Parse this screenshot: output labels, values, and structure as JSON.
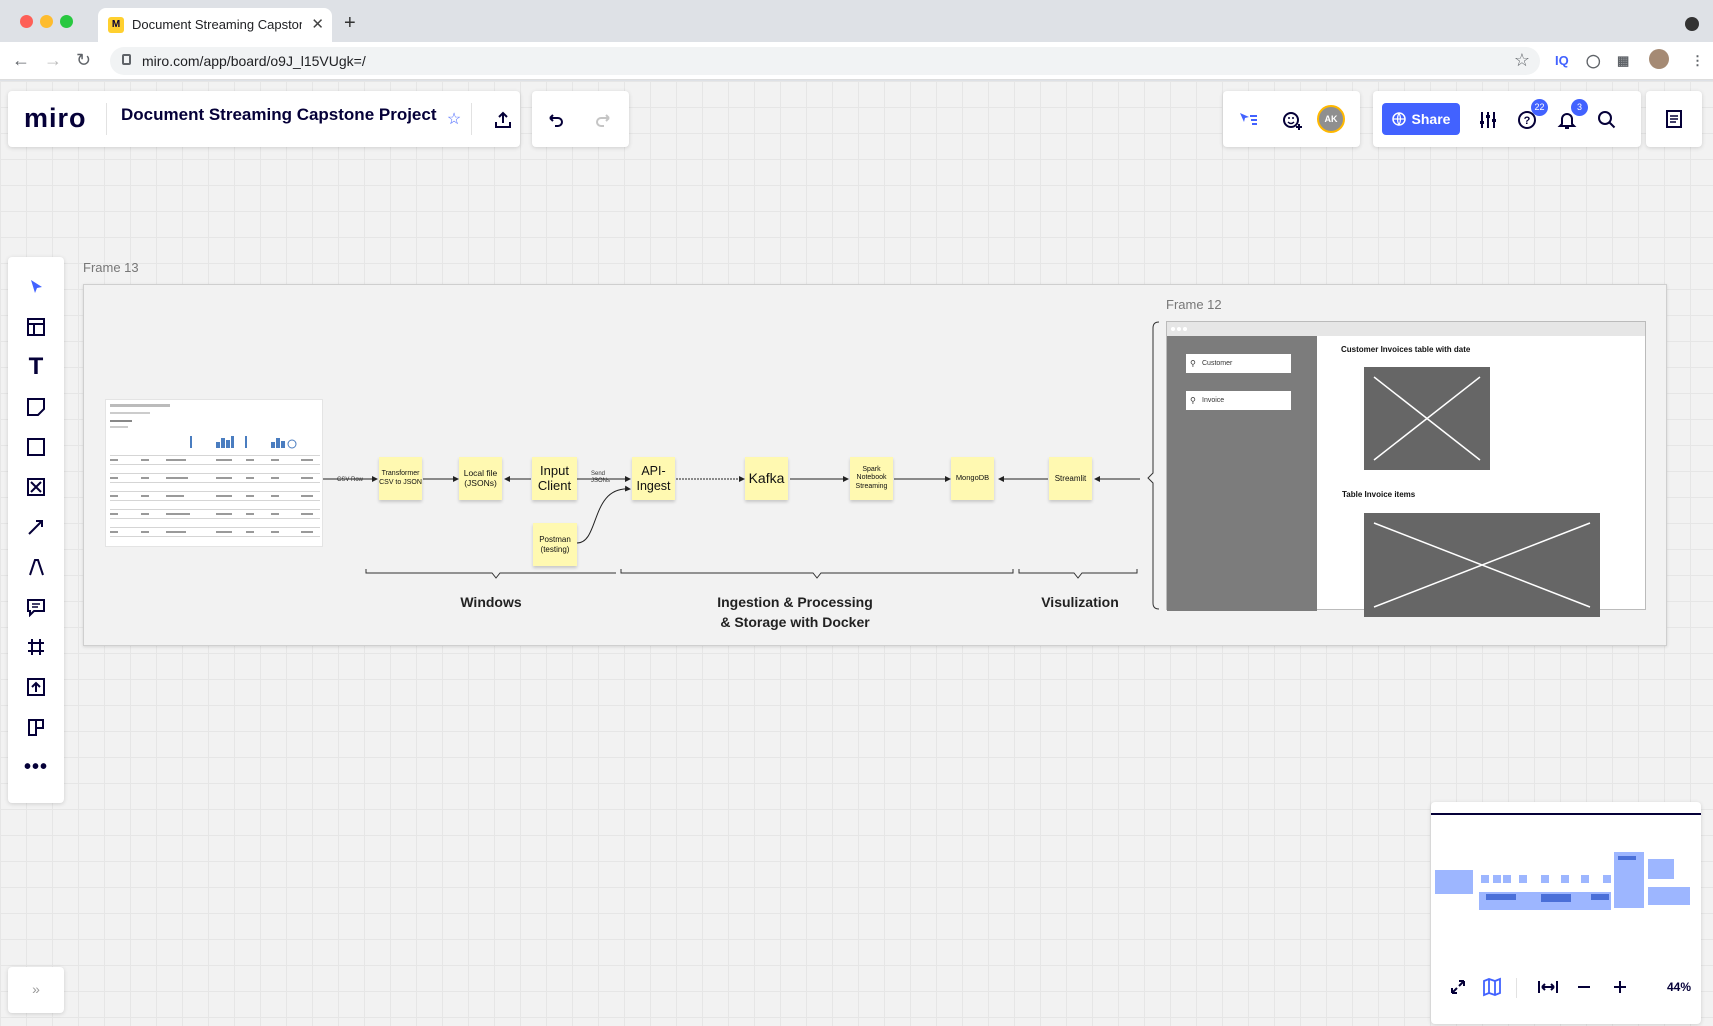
{
  "browser": {
    "tab_title": "Document Streaming Capstone Project",
    "tab_close": "✕",
    "new_tab": "+",
    "url": "miro.com/app/board/o9J_l15VUgk=/",
    "extension_iq": "IQ"
  },
  "header": {
    "logo": "miro",
    "board_title": "Document Streaming Capstone Project",
    "share_label": "Share",
    "help_badge": "22",
    "notifications_badge": "3",
    "avatar_initials": "AK"
  },
  "frames": {
    "outer_label": "Frame 13",
    "inner_label": "Frame 12"
  },
  "diagram": {
    "stickies": {
      "transformer": "Transformer CSV to JSON",
      "local_file": "Local file (JSONs)",
      "input_client": "Input Client",
      "api_ingest": "API-Ingest",
      "kafka": "Kafka",
      "spark": "Spark Notebook Streaming",
      "mongodb": "MongoDB",
      "streamlit": "Streamlit",
      "postman": "Postman (testing)"
    },
    "edge_labels": {
      "csv_row": "CSV Row",
      "send_jsons": "Send JSONs"
    },
    "groups": {
      "windows": "Windows",
      "ingestion_line1": "Ingestion & Processing",
      "ingestion_line2": "& Storage with Docker",
      "visualization": "Visulization"
    }
  },
  "wireframe": {
    "customer_input": "Customer",
    "invoice_input": "Invoice",
    "customer_table_title": "Customer Invoices table with date",
    "invoice_items_title": "Table Invoice items"
  },
  "zoom": {
    "level": "44%"
  },
  "colors": {
    "accent": "#4262ff",
    "sticky": "#fff9b1",
    "ink": "#050038"
  }
}
